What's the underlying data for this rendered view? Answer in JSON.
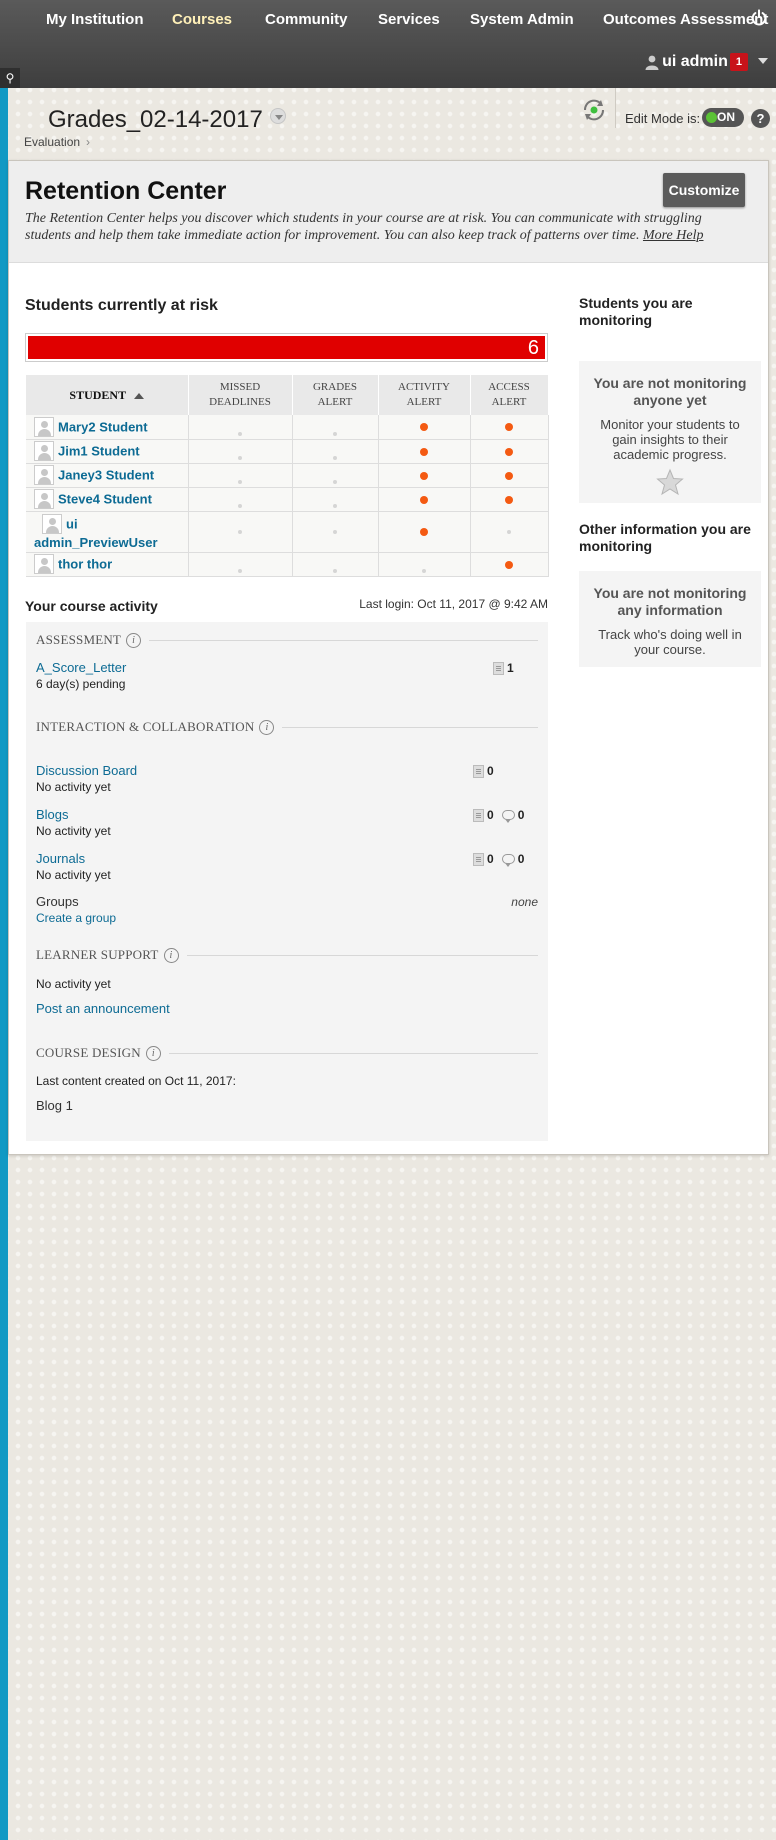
{
  "nav": {
    "tabs": [
      {
        "label": "My Institution",
        "active": false
      },
      {
        "label": "Courses",
        "active": true
      },
      {
        "label": "Community",
        "active": false
      },
      {
        "label": "Services",
        "active": false
      },
      {
        "label": "System Admin",
        "active": false
      },
      {
        "label": "Outcomes Assessment",
        "active": false
      }
    ],
    "user_name": "ui admin",
    "notification_count": "1",
    "icons": {
      "power": "power-icon",
      "user": "user-icon",
      "pin": "pin-icon"
    }
  },
  "course": {
    "title": "Grades_02-14-2017",
    "breadcrumb": "Evaluation",
    "breadcrumb_sep": "›",
    "edit_mode_label": "Edit Mode is:",
    "edit_mode_state": "ON",
    "help_label": "?"
  },
  "retention": {
    "title": "Retention Center",
    "customize_label": "Customize",
    "description": "The Retention Center helps you discover which students in your course are at risk. You can communicate with struggling students and help them take immediate action for improvement. You can also keep track of patterns over time.",
    "more_help": "More Help"
  },
  "at_risk": {
    "title": "Students currently at risk",
    "count": "6",
    "columns": {
      "student": "STUDENT",
      "missed_line1": "MISSED",
      "missed_line2": "DEADLINES",
      "grades_line1": "GRADES",
      "grades_line2": "ALERT",
      "activity_line1": "ACTIVITY",
      "activity_line2": "ALERT",
      "access_line1": "ACCESS",
      "access_line2": "ALERT"
    },
    "rows": [
      {
        "name": "Mary2 Student",
        "missed": false,
        "grades": false,
        "activity": true,
        "access": true
      },
      {
        "name": "Jim1 Student",
        "missed": false,
        "grades": false,
        "activity": true,
        "access": true
      },
      {
        "name": "Janey3 Student",
        "missed": false,
        "grades": false,
        "activity": true,
        "access": true
      },
      {
        "name": "Steve4 Student",
        "missed": false,
        "grades": false,
        "activity": true,
        "access": true
      },
      {
        "name_line1": "ui",
        "name_line2": "admin_PreviewUser",
        "missed": false,
        "grades": false,
        "activity": true,
        "access": false
      },
      {
        "name": "thor thor",
        "missed": false,
        "grades": false,
        "activity": false,
        "access": true
      }
    ],
    "alert_color": "#f45a12",
    "bar_color": "#e00000"
  },
  "monitoring": {
    "title": "Students you are monitoring",
    "empty_heading": "You are not monitoring anyone yet",
    "empty_text": "Monitor your students to gain insights to their academic progress.",
    "other_title": "Other information you are monitoring",
    "other_heading": "You are not monitoring any information",
    "other_text": "Track who's doing well in your course."
  },
  "activity": {
    "title": "Your course activity",
    "last_login_label": "Last login:",
    "last_login_value": "Oct 11, 2017 @ 9:42 AM",
    "assessment": {
      "heading": "ASSESSMENT",
      "item_label": "A_Score_Letter",
      "item_note": "6 day(s) pending",
      "item_count": "1"
    },
    "interaction": {
      "heading": "INTERACTION & COLLABORATION",
      "discussion_label": "Discussion Board",
      "discussion_note": "No activity yet",
      "discussion_count": "0",
      "blogs_label": "Blogs",
      "blogs_note": "No activity yet",
      "blogs_posts": "0",
      "blogs_comments": "0",
      "journals_label": "Journals",
      "journals_note": "No activity yet",
      "journals_posts": "0",
      "journals_comments": "0",
      "groups_label": "Groups",
      "groups_value": "none",
      "create_group": "Create a group"
    },
    "learner_support": {
      "heading": "LEARNER SUPPORT",
      "note": "No activity yet",
      "post_link": "Post an announcement"
    },
    "course_design": {
      "heading": "COURSE DESIGN",
      "note": "Last content created on Oct 11, 2017:",
      "item": "Blog 1"
    }
  }
}
